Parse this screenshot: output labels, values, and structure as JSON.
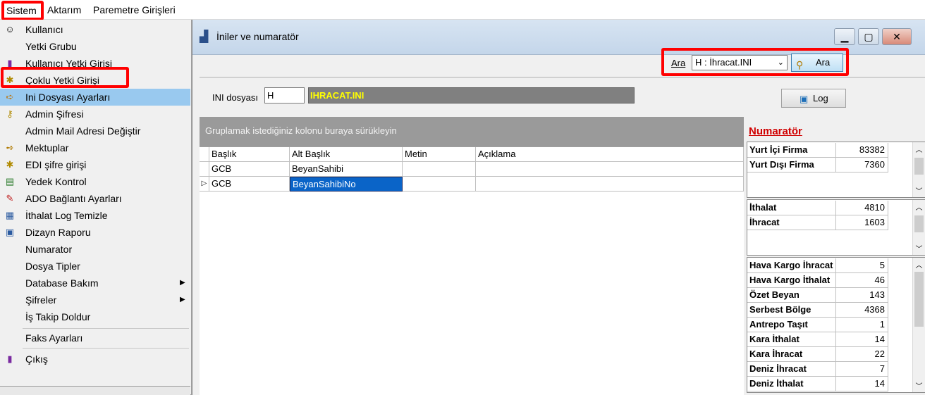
{
  "menubar": {
    "items": [
      "Sistem",
      "Aktarım",
      "Paremetre Girişleri"
    ]
  },
  "sistem_menu": {
    "items": [
      {
        "label": "Kullanıcı",
        "icon": "user-icon"
      },
      {
        "label": "Yetki Grubu",
        "icon": ""
      },
      {
        "label": "Kullanıcı Yetki Girişi",
        "icon": "door-icon"
      },
      {
        "label": "Çoklu Yetki Girişi",
        "icon": "key-icon"
      },
      {
        "label": "Ini Dosyası  Ayarları",
        "icon": "ini-settings-icon"
      },
      {
        "label": "Admin Şifresi",
        "icon": "key-icon"
      },
      {
        "label": "Admin Mail Adresi Değiştir",
        "icon": ""
      },
      {
        "label": "Mektuplar",
        "icon": "letter-icon"
      },
      {
        "label": "EDI şifre girişi",
        "icon": "key-icon"
      },
      {
        "label": "Yedek Kontrol",
        "icon": "backup-icon"
      },
      {
        "label": "ADO Bağlantı Ayarları",
        "icon": "connection-icon"
      },
      {
        "label": "İthalat Log Temizle",
        "icon": "clean-log-icon"
      },
      {
        "label": "Dizayn Raporu",
        "icon": "report-icon"
      },
      {
        "label": "Numarator",
        "icon": ""
      },
      {
        "label": "Dosya Tipler",
        "icon": ""
      },
      {
        "label": "Database Bakım",
        "icon": "",
        "submenu": true
      },
      {
        "label": "Şifreler",
        "icon": "",
        "submenu": true
      },
      {
        "label": "İş Takip Doldur",
        "icon": ""
      },
      {
        "label": "Faks Ayarları",
        "icon": ""
      },
      {
        "label": "Çıkış",
        "icon": "exit-door-icon"
      }
    ],
    "selected": "Ini Dosyası  Ayarları"
  },
  "window": {
    "title": "İniler ve numaratör"
  },
  "search": {
    "label": "Ara",
    "selected_ini": "H : İhracat.INI",
    "button_label": "Ara"
  },
  "ini": {
    "label": "INI dosyası",
    "code": "H",
    "name": "IHRACAT.INI",
    "log_button": "Log"
  },
  "grid": {
    "group_hint": "Gruplamak istediğiniz kolonu buraya sürükleyin",
    "columns": [
      "Başlık",
      "Alt Başlık",
      "Metin",
      "Açıklama"
    ],
    "rows": [
      [
        "GCB",
        "BeyanSahibi",
        "",
        ""
      ],
      [
        "GCB",
        "BeyanSahibiNo",
        "",
        ""
      ]
    ]
  },
  "numarator": {
    "title": "Numaratör",
    "panel1": [
      {
        "label": "Yurt İçi Firma",
        "value": "83382"
      },
      {
        "label": "Yurt Dışı Firma",
        "value": "7360"
      }
    ],
    "panel2": [
      {
        "label": "İthalat",
        "value": "4810"
      },
      {
        "label": "İhracat",
        "value": "1603"
      }
    ],
    "panel3": [
      {
        "label": "Hava Kargo İhracat",
        "value": "5"
      },
      {
        "label": "Hava Kargo İthalat",
        "value": "46"
      },
      {
        "label": "Özet Beyan",
        "value": "143"
      },
      {
        "label": "Serbest Bölge",
        "value": "4368"
      },
      {
        "label": "Antrepo Taşıt",
        "value": "1"
      },
      {
        "label": "Kara İthalat",
        "value": "14"
      },
      {
        "label": "Kara İhracat",
        "value": "22"
      },
      {
        "label": "Deniz İhracat",
        "value": "7"
      },
      {
        "label": "Deniz İthalat",
        "value": "14"
      }
    ]
  },
  "colors": {
    "highlight_red": "#ff0000",
    "selected_menu": "#99c9ef",
    "selected_cell": "#0a64c8",
    "numarator_title": "#d00000"
  }
}
